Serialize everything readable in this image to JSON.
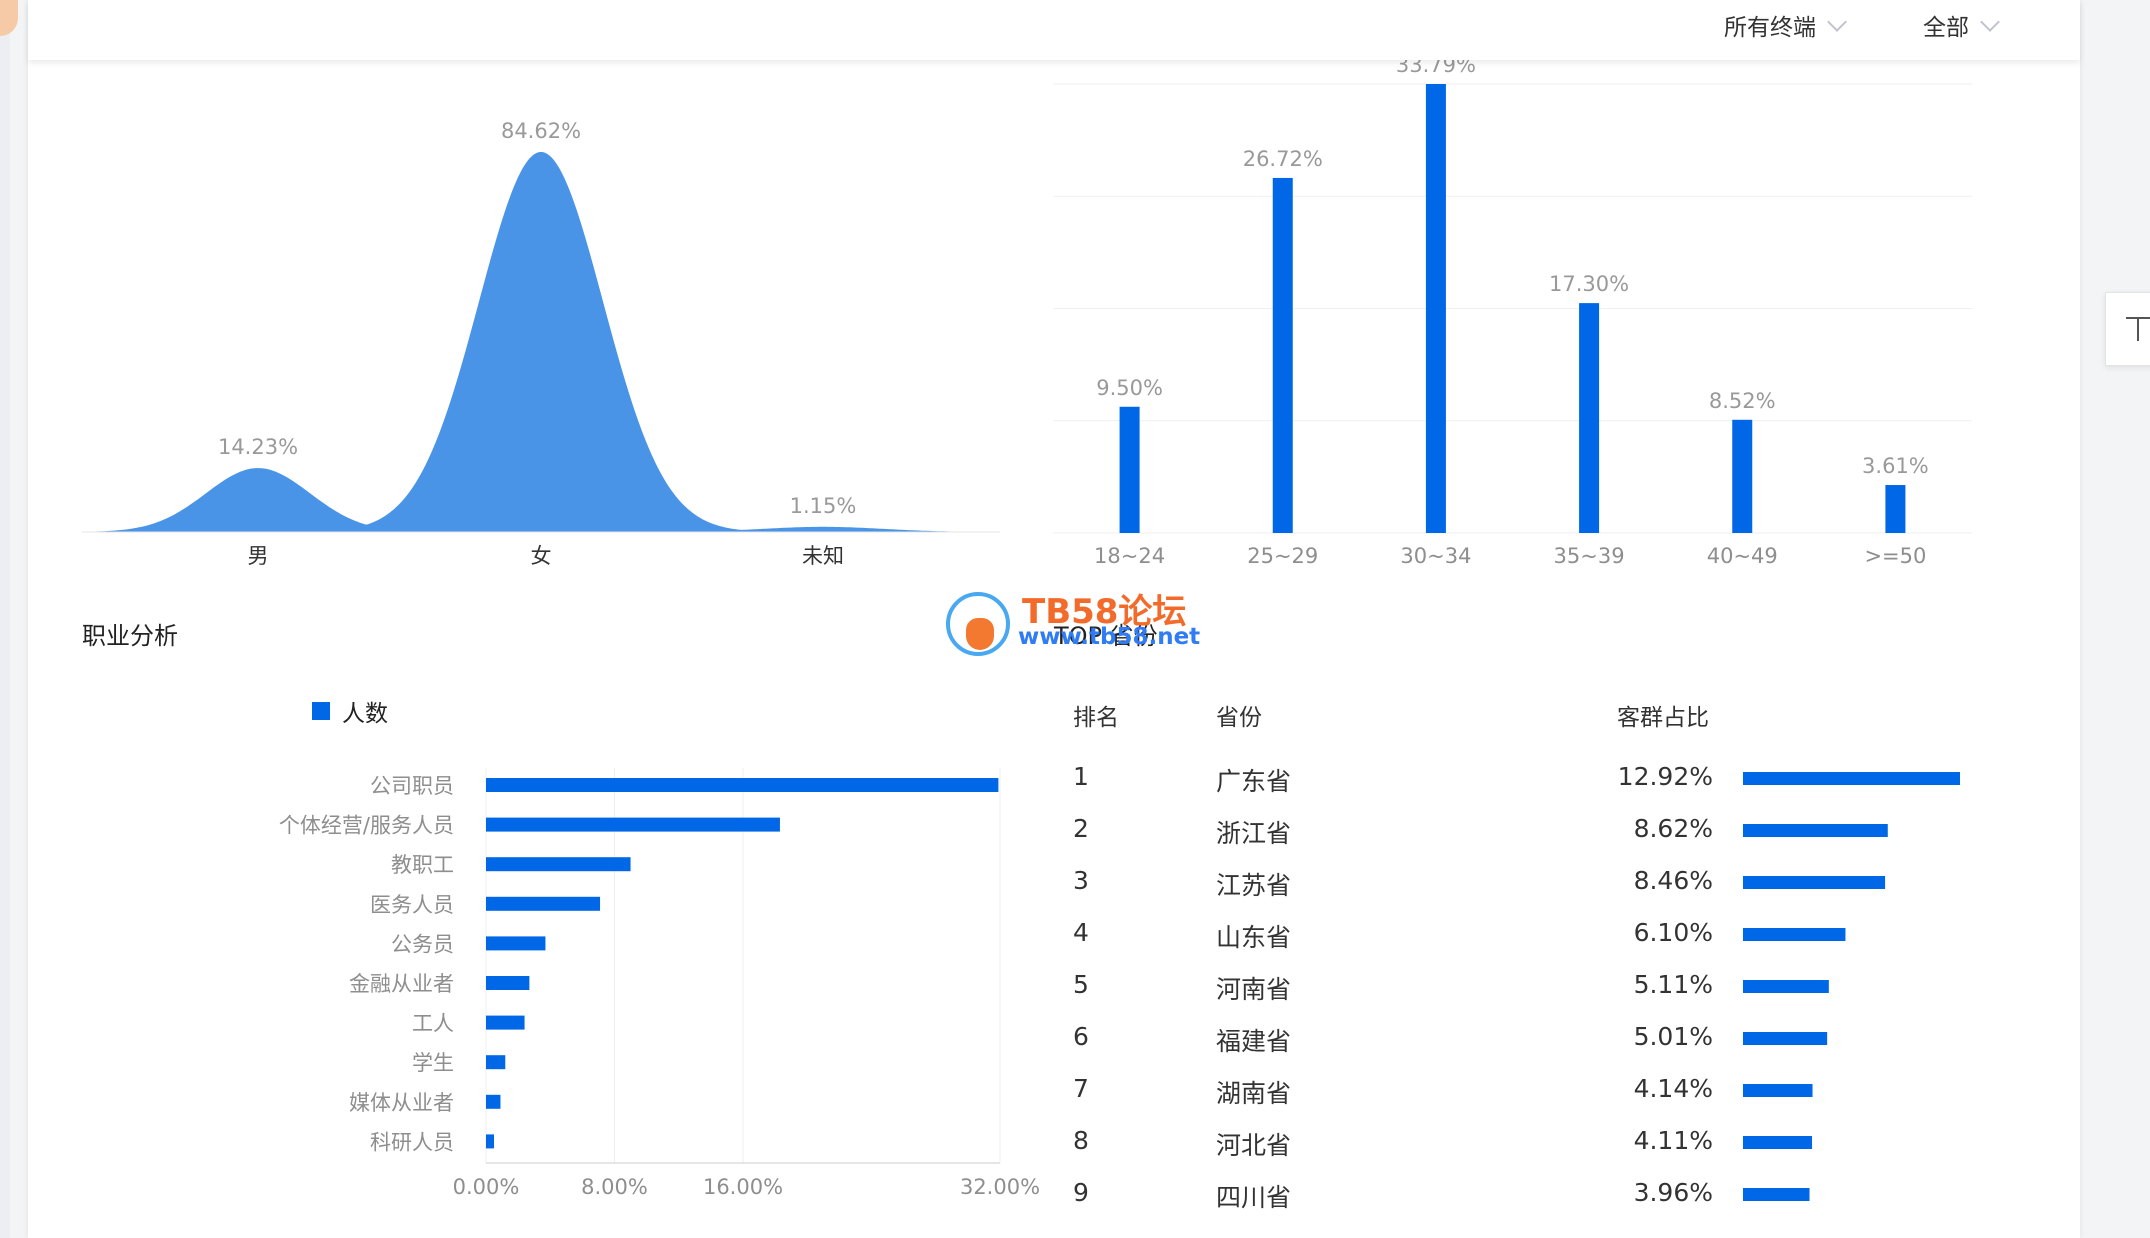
{
  "toolbar": {
    "terminal_filter": "所有终端",
    "scope_filter": "全部"
  },
  "sections": {
    "occupation_title": "职业分析",
    "province_title": "TOP 省份"
  },
  "watermark": {
    "brand": "TB58论坛",
    "url": "www.tb58.net"
  },
  "colors": {
    "accent": "#0067e6",
    "gender_fill": "#4a94e8",
    "grid": "#eeeeee"
  },
  "province_table": {
    "headers": [
      "排名",
      "省份",
      "客群占比"
    ],
    "rows": [
      {
        "rank": "1",
        "province": "广东省",
        "share": "12.92%",
        "value": 12.92
      },
      {
        "rank": "2",
        "province": "浙江省",
        "share": "8.62%",
        "value": 8.62
      },
      {
        "rank": "3",
        "province": "江苏省",
        "share": "8.46%",
        "value": 8.46
      },
      {
        "rank": "4",
        "province": "山东省",
        "share": "6.10%",
        "value": 6.1
      },
      {
        "rank": "5",
        "province": "河南省",
        "share": "5.11%",
        "value": 5.11
      },
      {
        "rank": "6",
        "province": "福建省",
        "share": "5.01%",
        "value": 5.01
      },
      {
        "rank": "7",
        "province": "湖南省",
        "share": "4.14%",
        "value": 4.14
      },
      {
        "rank": "8",
        "province": "河北省",
        "share": "4.11%",
        "value": 4.11
      },
      {
        "rank": "9",
        "province": "四川省",
        "share": "3.96%",
        "value": 3.96
      }
    ]
  },
  "chart_data": [
    {
      "type": "area",
      "categories": [
        "男",
        "女",
        "未知"
      ],
      "values": [
        14.23,
        84.62,
        1.15
      ],
      "data_labels": [
        "14.23%",
        "84.62%",
        "1.15%"
      ],
      "ylim": [
        0,
        84.62
      ]
    },
    {
      "type": "bar",
      "categories": [
        "18~24",
        "25~29",
        "30~34",
        "35~39",
        "40~49",
        ">=50"
      ],
      "values": [
        9.5,
        26.72,
        33.79,
        17.3,
        8.52,
        3.61
      ],
      "data_labels": [
        "9.50%",
        "26.72%",
        "33.79%",
        "17.30%",
        "8.52%",
        "3.61%"
      ],
      "ylim": [
        0,
        33.79
      ],
      "grid": true
    },
    {
      "type": "bar",
      "orientation": "horizontal",
      "categories": [
        "公司职员",
        "个体经营/服务人员",
        "教职工",
        "医务人员",
        "公务员",
        "金融从业者",
        "工人",
        "学生",
        "媒体从业者",
        "科研人员"
      ],
      "series": [
        {
          "name": "人数",
          "values": [
            31.9,
            18.3,
            9.0,
            7.1,
            3.7,
            2.7,
            2.4,
            1.2,
            0.9,
            0.5
          ]
        }
      ],
      "xlim": [
        0,
        32
      ],
      "xticks": [
        "0.00%",
        "8.00%",
        "16.00%",
        "32.00%"
      ],
      "xtick_values": [
        0,
        8,
        16,
        32
      ],
      "legend_position": "top-left",
      "grid": true
    }
  ]
}
